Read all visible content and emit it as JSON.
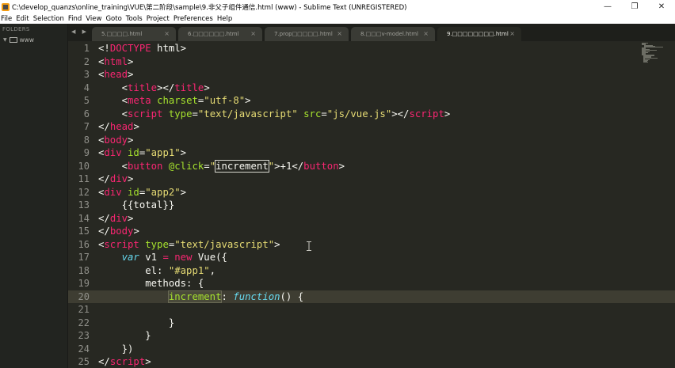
{
  "window": {
    "title": "C:\\develop_quanzs\\online_training\\VUE\\第二阶段\\sample\\9.非父子组件通信.html (www) - Sublime Text (UNREGISTERED)",
    "controls": {
      "minimize": "—",
      "maximize": "❐",
      "close": "✕"
    }
  },
  "menu": [
    "File",
    "Edit",
    "Selection",
    "Find",
    "View",
    "Goto",
    "Tools",
    "Project",
    "Preferences",
    "Help"
  ],
  "sidebar": {
    "header": "FOLDERS",
    "folder": "www"
  },
  "tab_nav": "◀ ▶",
  "tabs": [
    {
      "label": "5.□□□□.html",
      "close": "×",
      "active": false
    },
    {
      "label": "6.□□□□□□.html",
      "close": "×",
      "active": false
    },
    {
      "label": "7.prop□□□□□.html",
      "close": "×",
      "active": false
    },
    {
      "label": "8.□□□v-model.html",
      "close": "×",
      "active": false
    },
    {
      "label": "9.□□□□□□□□.html",
      "close": "×",
      "active": true
    }
  ],
  "line_numbers": [
    "1",
    "2",
    "3",
    "4",
    "5",
    "6",
    "7",
    "8",
    "9",
    "10",
    "11",
    "12",
    "13",
    "14",
    "15",
    "16",
    "17",
    "18",
    "19",
    "20",
    "21",
    "22",
    "23",
    "24",
    "25"
  ],
  "current_line": 20,
  "code_lines": [
    [
      [
        "txt",
        "<!"
      ],
      [
        "tag",
        "DOCTYPE"
      ],
      [
        "txt",
        " html>"
      ]
    ],
    [
      [
        "txt",
        "<"
      ],
      [
        "tag",
        "html"
      ],
      [
        "txt",
        ">"
      ]
    ],
    [
      [
        "txt",
        "<"
      ],
      [
        "tag",
        "head"
      ],
      [
        "txt",
        ">"
      ]
    ],
    [
      [
        "txt",
        "    <"
      ],
      [
        "tag",
        "title"
      ],
      [
        "txt",
        "></"
      ],
      [
        "tag",
        "title"
      ],
      [
        "txt",
        ">"
      ]
    ],
    [
      [
        "txt",
        "    <"
      ],
      [
        "tag",
        "meta"
      ],
      [
        "txt",
        " "
      ],
      [
        "attr",
        "charset"
      ],
      [
        "txt",
        "="
      ],
      [
        "str",
        "\"utf-8\""
      ],
      [
        "txt",
        ">"
      ]
    ],
    [
      [
        "txt",
        "    <"
      ],
      [
        "tag",
        "script"
      ],
      [
        "txt",
        " "
      ],
      [
        "attr",
        "type"
      ],
      [
        "txt",
        "="
      ],
      [
        "str",
        "\"text/javascript\""
      ],
      [
        "txt",
        " "
      ],
      [
        "attr",
        "src"
      ],
      [
        "txt",
        "="
      ],
      [
        "str",
        "\"js/vue.js\""
      ],
      [
        "txt",
        "></"
      ],
      [
        "tag",
        "script"
      ],
      [
        "txt",
        ">"
      ]
    ],
    [
      [
        "txt",
        "</"
      ],
      [
        "tag",
        "head"
      ],
      [
        "txt",
        ">"
      ]
    ],
    [
      [
        "txt",
        "<"
      ],
      [
        "tag",
        "body"
      ],
      [
        "txt",
        ">"
      ]
    ],
    [
      [
        "txt",
        "<"
      ],
      [
        "tag",
        "div"
      ],
      [
        "txt",
        " "
      ],
      [
        "attr",
        "id"
      ],
      [
        "txt",
        "="
      ],
      [
        "str",
        "\"app1\""
      ],
      [
        "txt",
        ">"
      ]
    ],
    [
      [
        "txt",
        "    <"
      ],
      [
        "tag",
        "button"
      ],
      [
        "txt",
        " "
      ],
      [
        "attr",
        "@click"
      ],
      [
        "txt",
        "="
      ],
      [
        "str",
        "\""
      ],
      [
        "sel",
        "increment"
      ],
      [
        "str",
        "\""
      ],
      [
        "txt",
        ">+1</"
      ],
      [
        "tag",
        "button"
      ],
      [
        "txt",
        ">"
      ]
    ],
    [
      [
        "txt",
        "</"
      ],
      [
        "tag",
        "div"
      ],
      [
        "txt",
        ">"
      ]
    ],
    [
      [
        "txt",
        "<"
      ],
      [
        "tag",
        "div"
      ],
      [
        "txt",
        " "
      ],
      [
        "attr",
        "id"
      ],
      [
        "txt",
        "="
      ],
      [
        "str",
        "\"app2\""
      ],
      [
        "txt",
        ">"
      ]
    ],
    [
      [
        "txt",
        "    {{total}}"
      ]
    ],
    [
      [
        "txt",
        "</"
      ],
      [
        "tag",
        "div"
      ],
      [
        "txt",
        ">"
      ]
    ],
    [
      [
        "txt",
        "</"
      ],
      [
        "tag",
        "body"
      ],
      [
        "txt",
        ">"
      ]
    ],
    [
      [
        "txt",
        "<"
      ],
      [
        "tag",
        "script"
      ],
      [
        "txt",
        " "
      ],
      [
        "attr",
        "type"
      ],
      [
        "txt",
        "="
      ],
      [
        "str",
        "\"text/javascript\""
      ],
      [
        "txt",
        ">"
      ]
    ],
    [
      [
        "txt",
        "    "
      ],
      [
        "kw",
        "var"
      ],
      [
        "txt",
        " v1 "
      ],
      [
        "op",
        "="
      ],
      [
        "txt",
        " "
      ],
      [
        "op",
        "new"
      ],
      [
        "txt",
        " Vue({"
      ]
    ],
    [
      [
        "txt",
        "        el: "
      ],
      [
        "str",
        "\"#app1\""
      ],
      [
        "txt",
        ","
      ]
    ],
    [
      [
        "txt",
        "        methods: {"
      ]
    ],
    [
      [
        "txt",
        "            "
      ],
      [
        "hl",
        "increment"
      ],
      [
        "txt",
        ": "
      ],
      [
        "kw",
        "function"
      ],
      [
        "txt",
        "() {"
      ]
    ],
    [
      [
        "txt",
        ""
      ]
    ],
    [
      [
        "txt",
        "            }"
      ]
    ],
    [
      [
        "txt",
        "        }"
      ]
    ],
    [
      [
        "txt",
        "    })"
      ]
    ],
    [
      [
        "txt",
        "</"
      ],
      [
        "tag",
        "script"
      ],
      [
        "txt",
        ">"
      ]
    ]
  ]
}
